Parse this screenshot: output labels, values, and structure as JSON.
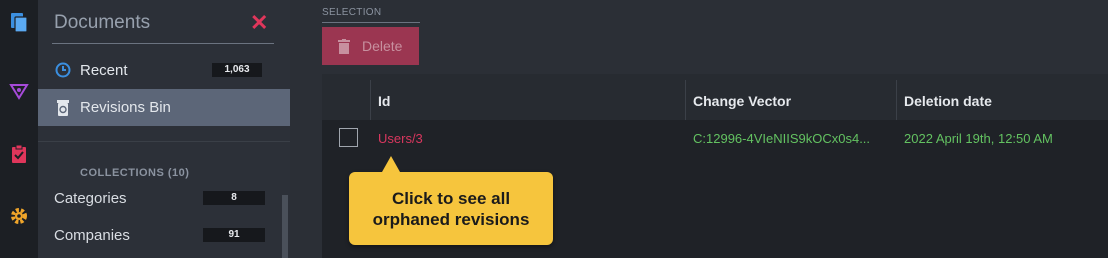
{
  "rail": {
    "icons": [
      "documents-icon",
      "indexes-icon",
      "tasks-icon",
      "settings-icon"
    ]
  },
  "sidebar": {
    "title": "Documents",
    "close_glyph": "✕",
    "items": [
      {
        "label": "Recent",
        "count": "1,063",
        "icon": "clock-icon"
      },
      {
        "label": "Revisions Bin",
        "icon": "revisions-bin-icon",
        "active": true
      }
    ],
    "collections_heading": "COLLECTIONS (10)",
    "collections": [
      {
        "label": "Categories",
        "count": "8"
      },
      {
        "label": "Companies",
        "count": "91"
      }
    ]
  },
  "toolbar": {
    "selection_label": "SELECTION",
    "delete_label": "Delete"
  },
  "table": {
    "columns": [
      "Id",
      "Change Vector",
      "Deletion date"
    ],
    "rows": [
      {
        "id": "Users/3",
        "change_vector": "C:12996-4VIeNIIS9kOCx0s4...",
        "deletion_date": "2022 April 19th, 12:50 AM"
      }
    ]
  },
  "tooltip": {
    "text": "Click to see all orphaned revisions"
  },
  "colors": {
    "accent_red": "#d8375e",
    "green": "#63c261",
    "tooltip": "#f6c53d",
    "delete_button": "#9b3651"
  }
}
